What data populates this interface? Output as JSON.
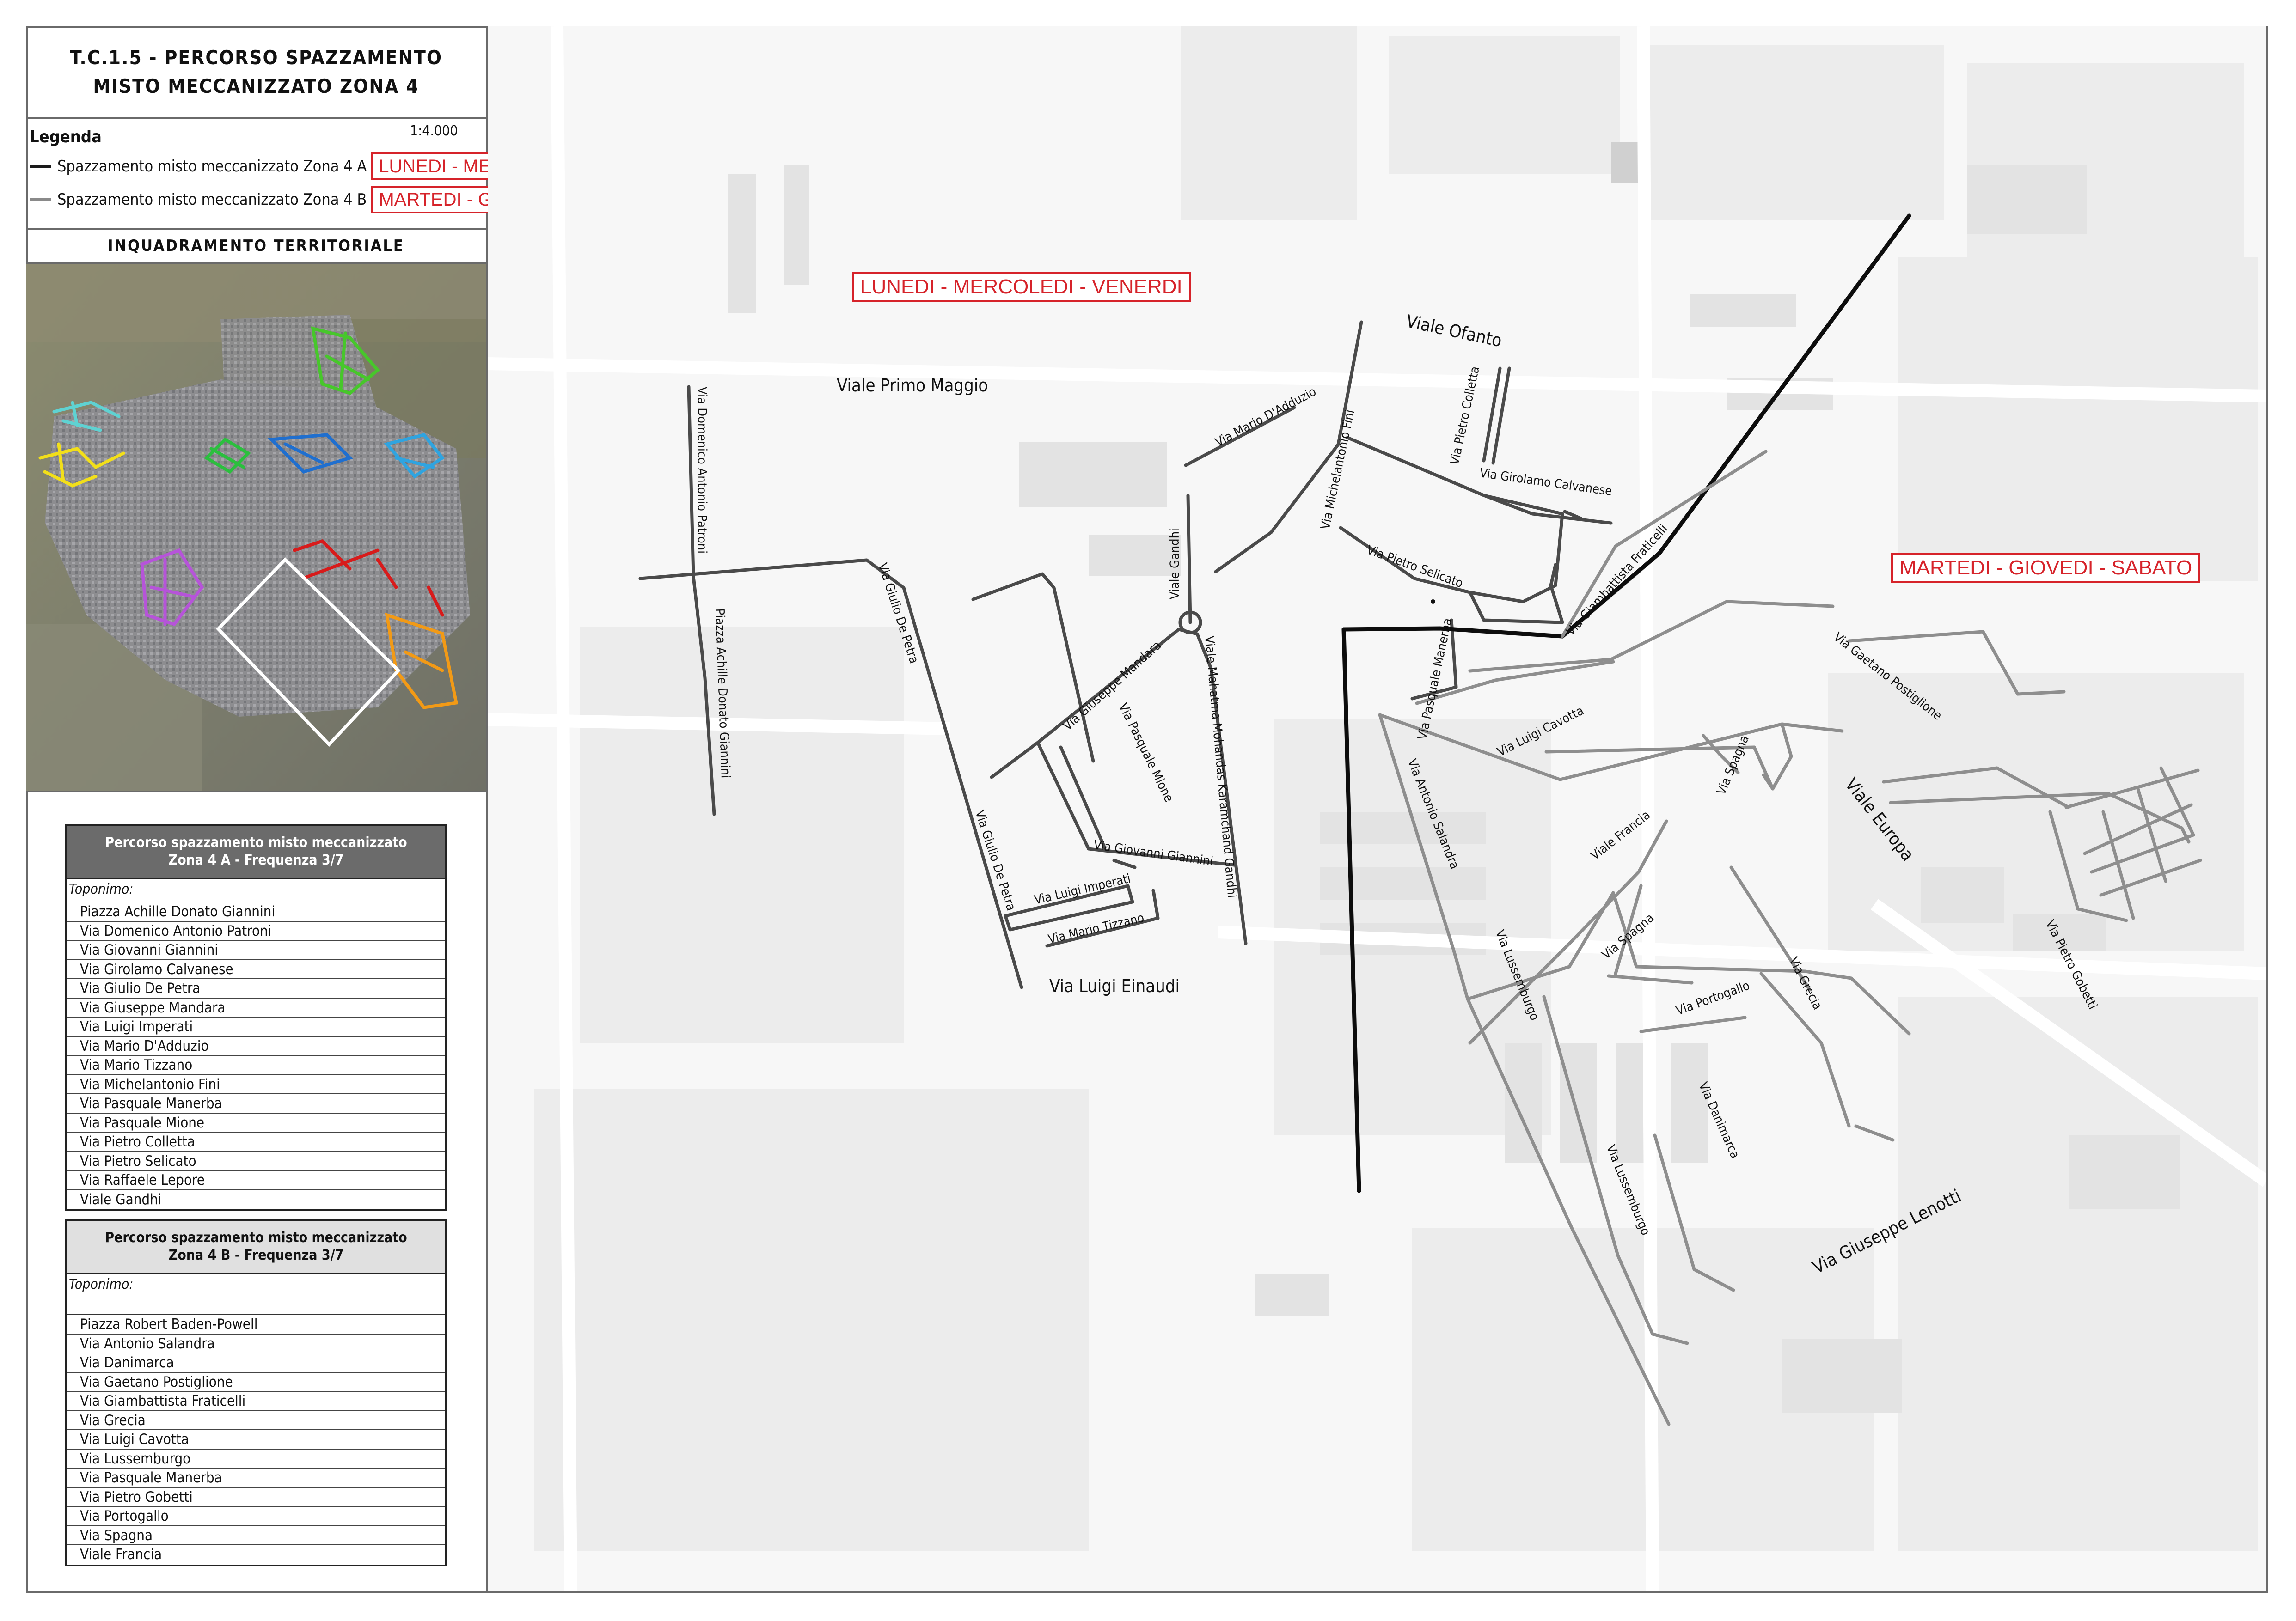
{
  "title": {
    "line1": "T.C.1.5 - PERCORSO SPAZZAMENTO",
    "line2": "MISTO MECCANIZZATO ZONA 4"
  },
  "legend": {
    "title": "Legenda",
    "scale": "1:4.000",
    "items": [
      {
        "label": "Spazzamento misto meccanizzato Zona 4 A",
        "days": "LUNEDI - MERCOLEDI - VENERDI",
        "color": "#1a1a1a"
      },
      {
        "label": "Spazzamento misto meccanizzato Zona 4 B",
        "days": "MARTEDI - GIOVEDI - SABATO",
        "color": "#8a8a8a"
      }
    ]
  },
  "inquadramento_title": "INQUADRAMENTO TERRITORIALE",
  "table_a": {
    "header": "Percorso spazzamento misto meccanizzato\nZona 4 A - Frequenza 3/7",
    "header_line1": "Percorso spazzamento misto meccanizzato",
    "header_line2": "Zona 4 A - Frequenza 3/7",
    "toponimo_label": "Toponimo:",
    "streets": [
      "Piazza Achille Donato Giannini",
      "Via Domenico Antonio Patroni",
      "Via Giovanni Giannini",
      "Via Girolamo Calvanese",
      "Via Giulio De Petra",
      "Via Giuseppe Mandara",
      "Via Luigi Imperati",
      "Via Mario D'Adduzio",
      "Via Mario Tizzano",
      "Via Michelantonio Fini",
      "Via Pasquale Manerba",
      "Via Pasquale Mione",
      "Via Pietro Colletta",
      "Via Pietro Selicato",
      "Via Raffaele Lepore",
      "Viale Gandhi"
    ]
  },
  "table_b": {
    "header_line1": "Percorso spazzamento misto meccanizzato",
    "header_line2": "Zona 4 B - Frequenza 3/7",
    "toponimo_label": "Toponimo:",
    "streets": [
      "Piazza Robert Baden-Powell",
      "Via Antonio Salandra",
      "Via Danimarca",
      "Via Gaetano Postiglione",
      "Via Giambattista Fraticelli",
      "Via Grecia",
      "Via Luigi Cavotta",
      "Via Lussemburgo",
      "Via Pasquale Manerba",
      "Via Pietro Gobetti",
      "Via Portogallo",
      "Via Spagna",
      "Viale Francia"
    ]
  },
  "map": {
    "zone_a_days": "LUNEDI - MERCOLEDI - VENERDI",
    "zone_b_days": "MARTEDI - GIOVEDI - SABATO",
    "labels": {
      "viale_primo_maggio": "Viale Primo Maggio",
      "viale_ofanto": "Viale Ofanto",
      "via_luigi_einaudi": "Via Luigi Einaudi",
      "viale_europa": "Viale Europa",
      "via_giuseppe_lenotti": "Via Giuseppe Lenotti",
      "via_domenico_antonio_patroni": "Via Domenico Antonio Patroni",
      "piazza_achille_donato_giannini": "Piazza Achille Donato Giannini",
      "via_giulio_de_petra_1": "Via Giulio De Petra",
      "via_giulio_de_petra_2": "Via Giulio De Petra",
      "via_giuseppe_mandara": "Via Giuseppe Mandara",
      "via_pasquale_mione": "Via Pasquale Mione",
      "via_giovanni_giannini": "Via Giovanni Giannini",
      "via_luigi_imperati": "Via Luigi Imperati",
      "via_mario_tizzano": "Via Mario Tizzano",
      "viale_gandhi": "Viale Gandhi",
      "viale_mahatma_gandhi": "Viale Mahatma Mohandas Karamchand Gandhi",
      "via_mario_dadduzio": "Via Mario D'Adduzio",
      "via_michelantonio_fini": "Via Michelantonio Fini",
      "via_pietro_colletta": "Via Pietro Colletta",
      "via_girolamo_calvanese": "Via Girolamo Calvanese",
      "via_pietro_selicato": "Via Pietro Selicato",
      "via_pasquale_manerba": "Via Pasquale Manerba",
      "via_giambattista_fraticelli": "Via Giambattista Fraticelli",
      "via_luigi_cavotta": "Via Luigi Cavotta",
      "via_antonio_salandra": "Via Antonio Salandra",
      "via_gaetano_postiglione": "Via Gaetano Postiglione",
      "viale_francia": "Viale Francia",
      "via_spagna_1": "Via Spagna",
      "via_spagna_2": "Via Spagna",
      "via_lussemburgo_1": "Via Lussemburgo",
      "via_lussemburgo_2": "Via Lussemburgo",
      "via_portogallo": "Via Portogallo",
      "via_grecia": "Via Grecia",
      "via_danimarca": "Via Danimarca",
      "via_pietro_gobetti": "Via Pietro Gobetti"
    }
  },
  "colors": {
    "zone_a": "#1a1a1a",
    "zone_b": "#8a8a8a",
    "red": "#d6232a"
  }
}
